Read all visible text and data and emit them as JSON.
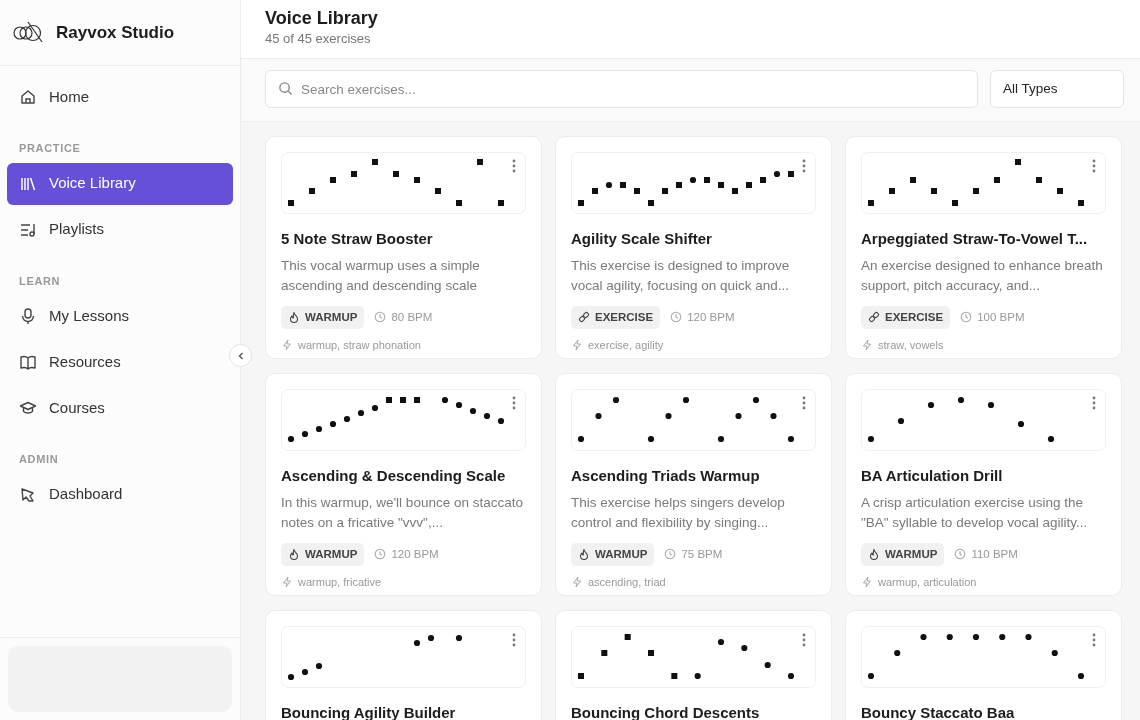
{
  "sidebar": {
    "brand": "Rayvox Studio",
    "top_items": [
      {
        "label": "Home",
        "selected": false
      }
    ],
    "sections": [
      {
        "heading": "PRACTICE",
        "items": [
          {
            "label": "Voice Library",
            "selected": true
          },
          {
            "label": "Playlists",
            "selected": false
          }
        ]
      },
      {
        "heading": "LEARN",
        "items": [
          {
            "label": "My Lessons",
            "selected": false
          },
          {
            "label": "Resources",
            "selected": false
          },
          {
            "label": "Courses",
            "selected": false
          }
        ]
      },
      {
        "heading": "ADMIN",
        "items": [
          {
            "label": "Dashboard",
            "selected": false
          }
        ]
      }
    ]
  },
  "header": {
    "title": "Voice Library",
    "subtitle": "45 of 45 exercises"
  },
  "filters": {
    "search": {
      "placeholder": "Search exercises..."
    },
    "type_select": "All Types"
  },
  "cards": [
    {
      "title": "5 Note Straw Booster",
      "description": "This vocal warmup uses a simple ascending and descending scale",
      "kind": "warmup",
      "type_label": "WARMUP",
      "tempo": "80 BPM",
      "tags": "warmup, straw phonation"
    },
    {
      "title": "Agility Scale Shifter",
      "description": "This exercise is designed to improve vocal agility, focusing on quick and...",
      "kind": "exercise",
      "type_label": "EXERCISE",
      "tempo": "120 BPM",
      "tags": "exercise, agility"
    },
    {
      "title": "Arpeggiated Straw-To-Vowel T...",
      "description": "An exercise designed to enhance breath support, pitch accuracy, and...",
      "kind": "exercise",
      "type_label": "EXERCISE",
      "tempo": "100 BPM",
      "tags": "straw, vowels"
    },
    {
      "title": "Ascending & Descending Scale",
      "description": "In this warmup, we'll bounce on staccato notes on a fricative \"vvv\",...",
      "kind": "warmup",
      "type_label": "WARMUP",
      "tempo": "120 BPM",
      "tags": "warmup, fricative"
    },
    {
      "title": "Ascending Triads Warmup",
      "description": "This exercise helps singers develop control and flexibility by singing...",
      "kind": "warmup",
      "type_label": "WARMUP",
      "tempo": "75 BPM",
      "tags": "ascending, triad"
    },
    {
      "title": "BA Articulation Drill",
      "description": "A crisp articulation exercise using the \"BA\" syllable to develop vocal agility...",
      "kind": "warmup",
      "type_label": "WARMUP",
      "tempo": "110 BPM",
      "tags": "warmup, articulation"
    },
    {
      "title": "Bouncing Agility Builder"
    },
    {
      "title": "Bouncing Chord Descents"
    },
    {
      "title": "Bouncy Staccato Baa"
    }
  ]
}
